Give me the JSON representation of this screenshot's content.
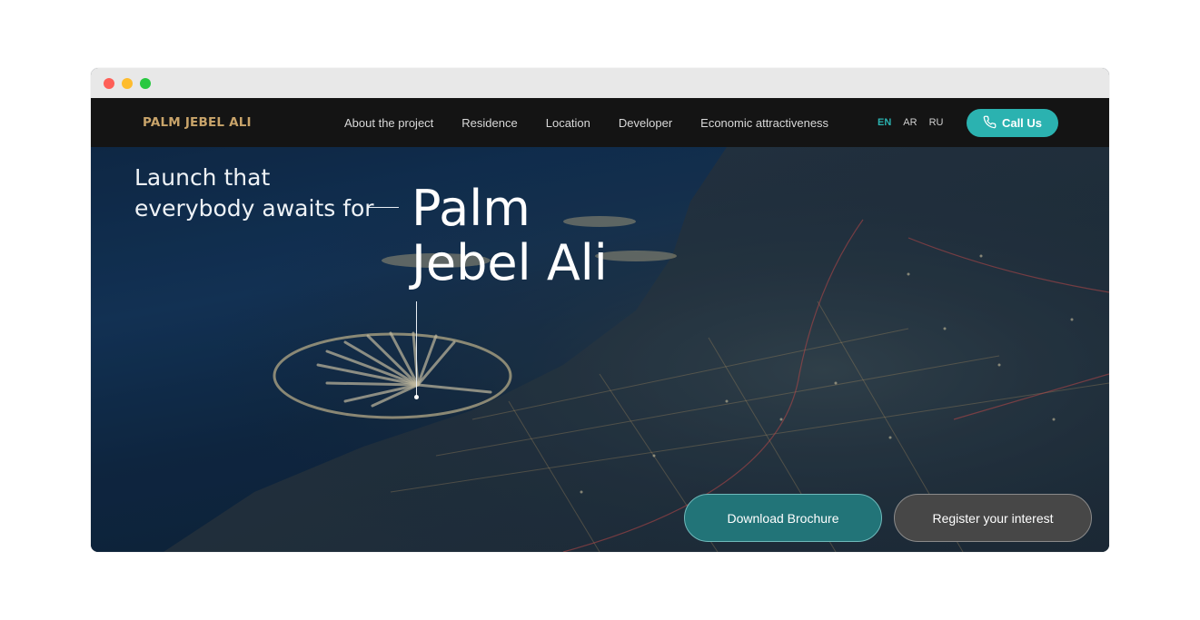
{
  "header": {
    "logo": "PALM JEBEL ALI",
    "nav": [
      {
        "label": "About the project"
      },
      {
        "label": "Residence"
      },
      {
        "label": "Location"
      },
      {
        "label": "Developer"
      },
      {
        "label": "Economic attractiveness"
      }
    ],
    "languages": [
      {
        "label": "EN",
        "active": true
      },
      {
        "label": "AR",
        "active": false
      },
      {
        "label": "RU",
        "active": false
      }
    ],
    "call_button": {
      "label": "Call Us",
      "icon": "phone-icon"
    }
  },
  "hero": {
    "tagline_line1": "Launch that",
    "tagline_line2": "everybody awaits for",
    "title_line1": "Palm",
    "title_line2": "Jebel Ali",
    "download_button": "Download Brochure",
    "register_button": "Register your interest"
  },
  "colors": {
    "accent": "#2bb2b0",
    "logo_gold": "#c9a46a",
    "nav_bg": "#141414",
    "brochure_btn": "#227478",
    "register_btn": "#474747"
  }
}
